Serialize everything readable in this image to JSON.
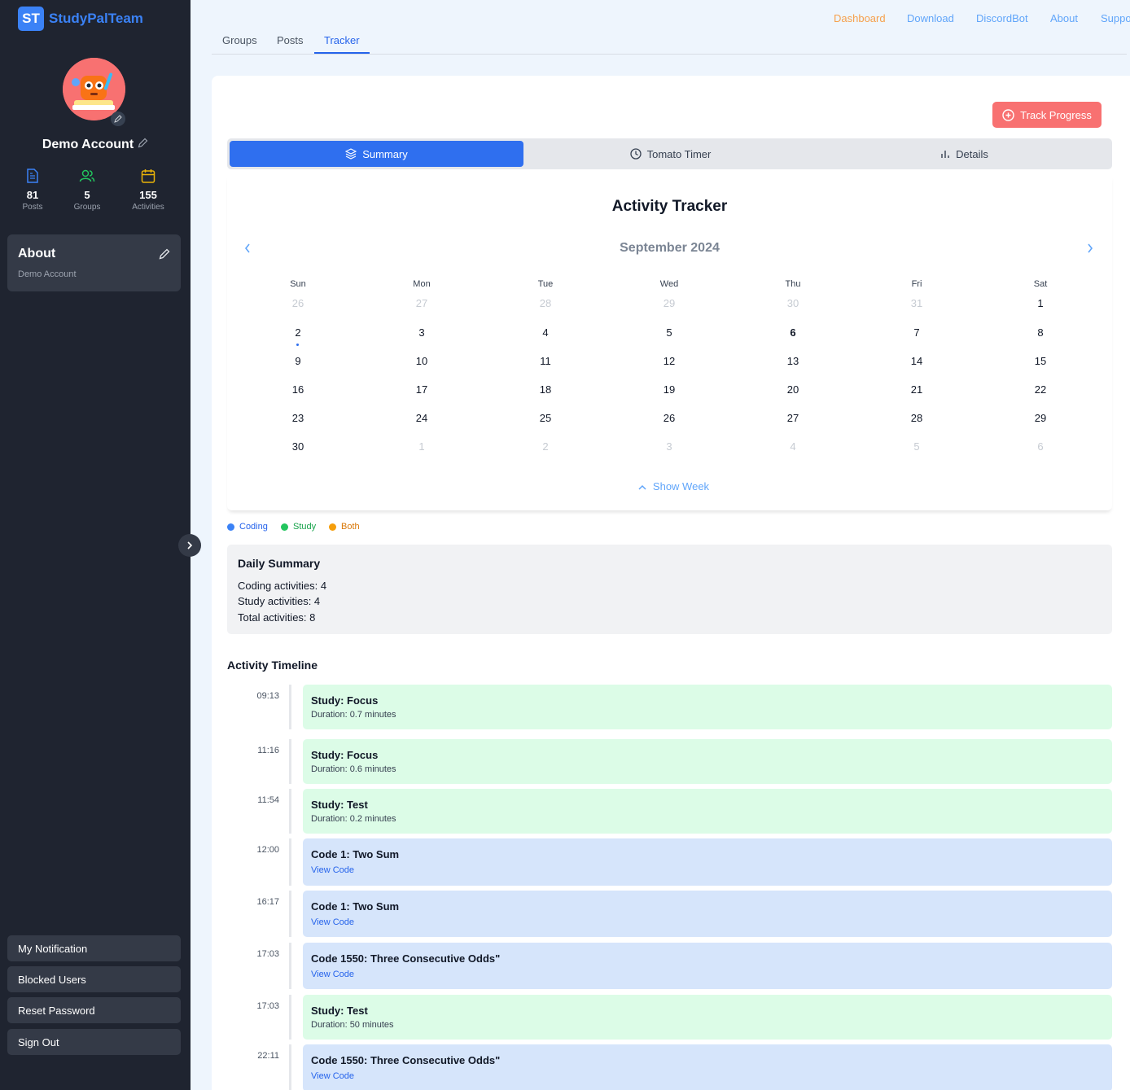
{
  "brand": {
    "logo": "ST",
    "name": "StudyPalTeam",
    "accent": "#3b82f6"
  },
  "profile": {
    "name": "Demo Account",
    "avatar_icon": "avatar-illustration"
  },
  "stats": [
    {
      "value": "81",
      "label": "Posts",
      "icon": "document-icon",
      "color": "#3b82f6"
    },
    {
      "value": "5",
      "label": "Groups",
      "icon": "users-icon",
      "color": "#22c55e"
    },
    {
      "value": "155",
      "label": "Activities",
      "icon": "calendar-icon",
      "color": "#eab308"
    }
  ],
  "about": {
    "title": "About",
    "subtitle": "Demo Account"
  },
  "sidebar_actions": [
    "My Notification",
    "Blocked Users",
    "Reset Password",
    "Sign Out"
  ],
  "topnav": [
    "Dashboard",
    "Download",
    "DiscordBot",
    "About",
    "Support"
  ],
  "tabs": [
    "Groups",
    "Posts",
    "Tracker"
  ],
  "active_tab": "Tracker",
  "track_button": "Track Progress",
  "segments": [
    "Summary",
    "Tomato Timer",
    "Details"
  ],
  "calendar": {
    "title": "Activity Tracker",
    "month": "September 2024",
    "weekdays": [
      "Sun",
      "Mon",
      "Tue",
      "Wed",
      "Thu",
      "Fri",
      "Sat"
    ],
    "weeks": [
      [
        "26",
        "27",
        "28",
        "29",
        "30",
        "31",
        "1"
      ],
      [
        "2",
        "3",
        "4",
        "5",
        "6",
        "7",
        "8"
      ],
      [
        "9",
        "10",
        "11",
        "12",
        "13",
        "14",
        "15"
      ],
      [
        "16",
        "17",
        "18",
        "19",
        "20",
        "21",
        "22"
      ],
      [
        "23",
        "24",
        "25",
        "26",
        "27",
        "28",
        "29"
      ],
      [
        "30",
        "1",
        "2",
        "3",
        "4",
        "5",
        "6"
      ]
    ],
    "selected": "5",
    "today": "6",
    "show_week": "Show Week"
  },
  "legend": [
    {
      "label": "Coding",
      "color": "#3b82f6",
      "text_color": "#2563eb"
    },
    {
      "label": "Study",
      "color": "#22c55e",
      "text_color": "#16a34a"
    },
    {
      "label": "Both",
      "color": "#f59e0b",
      "text_color": "#d97706"
    }
  ],
  "daily_summary": {
    "title": "Daily Summary",
    "lines": [
      "Coding activities: 4",
      "Study activities: 4",
      "Total activities: 8"
    ]
  },
  "timeline": {
    "title": "Activity Timeline",
    "items": [
      {
        "time": "09:13",
        "kind": "study",
        "title": "Study: Focus",
        "detail": "Duration: 0.7 minutes"
      },
      {
        "time": "11:16",
        "kind": "study",
        "title": "Study: Focus",
        "detail": "Duration: 0.6 minutes"
      },
      {
        "time": "11:54",
        "kind": "study",
        "title": "Study: Test",
        "detail": "Duration: 0.2 minutes"
      },
      {
        "time": "12:00",
        "kind": "code",
        "title": "Code 1: Two Sum",
        "detail": "View Code"
      },
      {
        "time": "16:17",
        "kind": "code",
        "title": "Code 1: Two Sum",
        "detail": "View Code"
      },
      {
        "time": "17:03",
        "kind": "code",
        "title": "Code 1550: Three Consecutive Odds\"",
        "detail": "View Code"
      },
      {
        "time": "17:03",
        "kind": "study",
        "title": "Study: Test",
        "detail": "Duration: 50 minutes"
      },
      {
        "time": "22:11",
        "kind": "code",
        "title": "Code 1550: Three Consecutive Odds\"",
        "detail": "View Code"
      }
    ]
  }
}
